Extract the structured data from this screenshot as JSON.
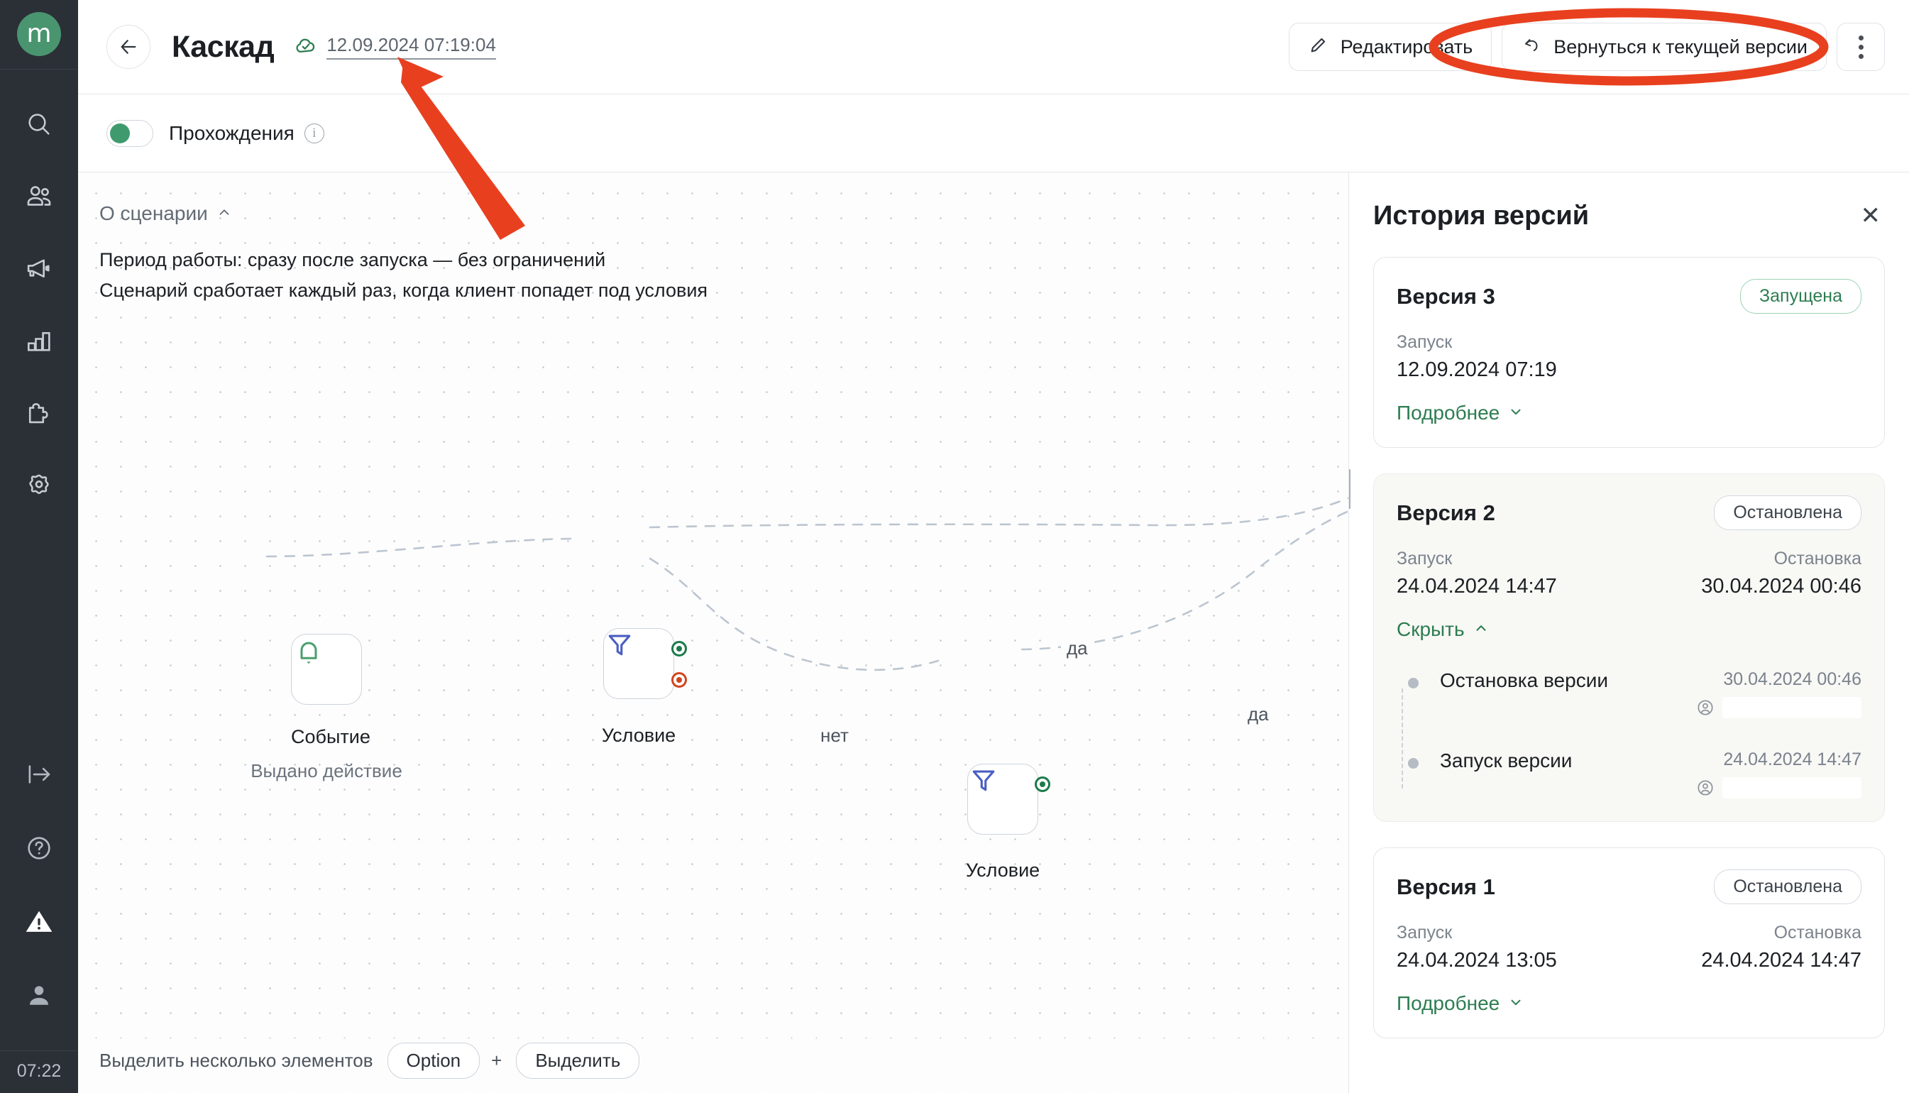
{
  "rail": {
    "logo_letter": "m",
    "time": "07:22",
    "icons": [
      {
        "name": "search-icon"
      },
      {
        "name": "users-icon"
      },
      {
        "name": "megaphone-icon"
      },
      {
        "name": "bar-chart-icon"
      },
      {
        "name": "puzzle-icon"
      },
      {
        "name": "gear-icon"
      }
    ],
    "bottom_icons": [
      {
        "name": "collapse-panel-icon"
      },
      {
        "name": "help-icon"
      },
      {
        "name": "warning-icon"
      },
      {
        "name": "account-icon"
      }
    ]
  },
  "header": {
    "back_label": "←",
    "title": "Каскад",
    "version_stamp": "12.09.2024 07:19:04",
    "edit_label": "Редактировать",
    "revert_label": "Вернуться к текущей версии",
    "more_label": ""
  },
  "toolbar": {
    "toggle_label": "Прохождения",
    "toggle_on": true,
    "info_glyph": "i"
  },
  "canvas": {
    "about_title": "О сценарии",
    "about_line1": "Период работы: сразу после запуска — без ограничений",
    "about_line2": "Сценарий сработает каждый раз, когда клиент попадет под условия",
    "nodes": [
      {
        "id": "event",
        "icon": "bell-icon",
        "label": "Событие",
        "sub": "Выдано действие"
      },
      {
        "id": "cond1",
        "icon": "filter-icon",
        "label": "Условие",
        "sub": ""
      },
      {
        "id": "cond2",
        "icon": "filter-icon",
        "label": "Условие",
        "sub": ""
      }
    ],
    "edge_labels": {
      "yes_top": "да",
      "no": "нет",
      "yes_bottom": "да"
    },
    "hint_text": "Выделить несколько элементов",
    "hint_key1": "Option",
    "hint_plus": "+",
    "hint_key2": "Выделить"
  },
  "panel": {
    "title": "История версий",
    "close_glyph": "✕",
    "labels": {
      "start": "Запуск",
      "stop": "Остановка",
      "more": "Подробнее",
      "hide": "Скрыть"
    },
    "versions": [
      {
        "title": "Версия 3",
        "badge": "Запущена",
        "badge_kind": "run",
        "start_label": "Запуск",
        "start_value": "12.09.2024 07:19",
        "stop_label": "",
        "stop_value": "",
        "toggle_label": "Подробнее",
        "expanded": false,
        "events": []
      },
      {
        "title": "Версия 2",
        "badge": "Остановлена",
        "badge_kind": "stop",
        "start_label": "Запуск",
        "start_value": "24.04.2024 14:47",
        "stop_label": "Остановка",
        "stop_value": "30.04.2024 00:46",
        "toggle_label": "Скрыть",
        "expanded": true,
        "events": [
          {
            "name": "Остановка версии",
            "time": "30.04.2024 00:46",
            "user": ""
          },
          {
            "name": "Запуск версии",
            "time": "24.04.2024 14:47",
            "user": ""
          }
        ]
      },
      {
        "title": "Версия 1",
        "badge": "Остановлена",
        "badge_kind": "stop",
        "start_label": "Запуск",
        "start_value": "24.04.2024 13:05",
        "stop_label": "Остановка",
        "stop_value": "24.04.2024 14:47",
        "toggle_label": "Подробнее",
        "expanded": false,
        "events": []
      }
    ]
  },
  "annotation": {
    "color": "#e8401f",
    "shapes": [
      "arrow-pointing-to-version-stamp",
      "ellipse-around-revert-button"
    ]
  },
  "colors": {
    "brand_green": "#49956f",
    "accent_green": "#2d7d51",
    "rail_bg": "#2b2f36",
    "annotation_red": "#e8401f",
    "node_blue": "#4a5fc1",
    "node_green": "#4a9e6e"
  }
}
